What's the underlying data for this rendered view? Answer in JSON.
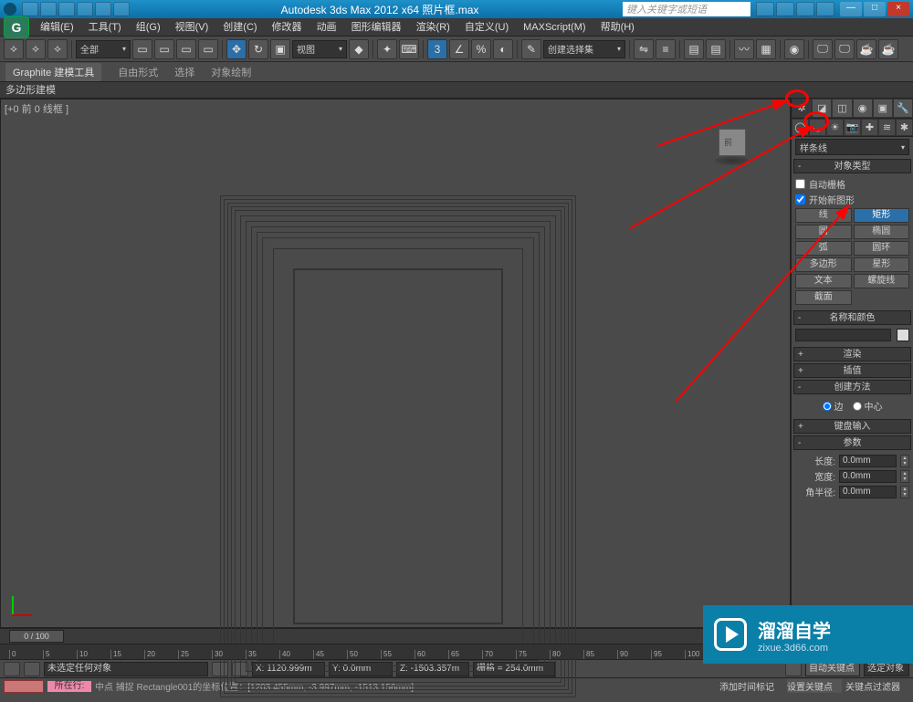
{
  "titlebar": {
    "title": "Autodesk 3ds Max 2012 x64   照片框.max",
    "search_placeholder": "键入关键字或短语",
    "min": "—",
    "max": "□",
    "close": "×"
  },
  "menu": {
    "logo": "G",
    "items": [
      "编辑(E)",
      "工具(T)",
      "组(G)",
      "视图(V)",
      "创建(C)",
      "修改器",
      "动画",
      "图形编辑器",
      "渲染(R)",
      "自定义(U)",
      "MAXScript(M)",
      "帮助(H)"
    ]
  },
  "toolbar": {
    "all": "全部",
    "view": "视图",
    "selset": "创建选择集"
  },
  "ribbon": {
    "tabs": [
      "Graphite 建模工具",
      "自由形式",
      "选择",
      "对象绘制"
    ],
    "sub": "多边形建模"
  },
  "viewport": {
    "label": "[+0 前 0 线框 ]",
    "cube": "前"
  },
  "panel": {
    "dropdown": "样条线",
    "rollouts": {
      "obj_type": "对象类型",
      "auto_grid": "自动栅格",
      "start_new": "开始新图形",
      "btns": {
        "line": "线",
        "rect": "矩形",
        "circle": "圆",
        "ellipse": "椭圆",
        "arc": "弧",
        "donut": "圆环",
        "ngon": "多边形",
        "star": "星形",
        "text": "文本",
        "helix": "螺旋线",
        "section": "截面"
      },
      "name_color": "名称和颜色",
      "render": "渲染",
      "interp": "插值",
      "creation": "创建方法",
      "edge": "边",
      "center": "中心",
      "kbd": "键盘输入",
      "params": "参数",
      "length": "长度:",
      "width": "宽度:",
      "corner": "角半径:",
      "val": "0.0mm"
    }
  },
  "timeline": {
    "slider": "0 / 100",
    "ticks": [
      "0",
      "5",
      "10",
      "15",
      "20",
      "25",
      "30",
      "35",
      "40",
      "45",
      "50",
      "55",
      "60",
      "65",
      "70",
      "75",
      "80",
      "85",
      "90",
      "95",
      "100"
    ]
  },
  "status": {
    "row1": {
      "none": "未选定任何对象",
      "x": "X: 1120.999m",
      "y": "Y: 0.0mm",
      "z": "Z: -1503.357m",
      "grid": "栅格 = 254.0mm",
      "autokey": "自动关键点",
      "selset": "选定对象"
    },
    "row2": {
      "go": "所在行:",
      "snap": "中点 捕捉 Rectangle001的坐标位置：[1203.455mm, -3.997mm, -1513.156mm]",
      "addtime": "添加时间标记",
      "setkey": "设置关键点",
      "filter": "关键点过滤器"
    }
  },
  "wm": {
    "t1": "溜溜自学",
    "t2": "zixue.3d66.com"
  }
}
